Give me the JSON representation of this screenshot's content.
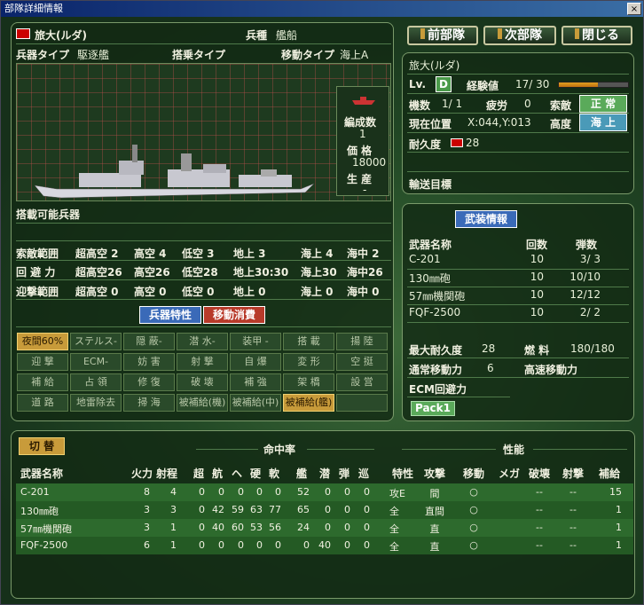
{
  "window": {
    "title": "部隊詳細情報",
    "close": "×"
  },
  "unit": {
    "name": "旅大(ルダ)",
    "category_label": "兵種",
    "category": "艦船",
    "weapon_type_label": "兵器タイプ",
    "weapon_type": "駆逐艦",
    "board_type_label": "搭乗タイプ",
    "move_type_label": "移動タイプ",
    "move_type": "海上A",
    "formation_label": "編成数",
    "formation": "1",
    "price_label": "価 格",
    "price": "18000",
    "production_label": "生 産",
    "production": "-",
    "carry_label": "搭載可能兵器"
  },
  "ranges": [
    {
      "label": "索敵範囲",
      "values": [
        "超高空 2",
        "高空 4",
        "低空 3",
        "地上 3",
        "海上 4",
        "海中 2"
      ]
    },
    {
      "label": "回 避 力",
      "values": [
        "超高空26",
        "高空26",
        "低空28",
        "地上30:30",
        "海上30",
        "海中26"
      ]
    },
    {
      "label": "迎撃範囲",
      "values": [
        "超高空 0",
        "高空 0",
        "低空 0",
        "地上 0",
        "海上 0",
        "海中 0"
      ]
    }
  ],
  "mode_tabs": [
    "兵器特性",
    "移動消費"
  ],
  "abilities": [
    [
      "夜間60%",
      "ステルス-",
      "隠 蔽-",
      "潜 水-",
      "装甲 -",
      "搭 載",
      "揚 陸"
    ],
    [
      "迎 撃",
      "ECM-",
      "妨 害",
      "射 撃",
      "自 爆",
      "変 形",
      "空 挺"
    ],
    [
      "補 給",
      "占 領",
      "修 復",
      "破 壊",
      "補 強",
      "架 橋",
      "設 営"
    ],
    [
      "道 路",
      "地雷除去",
      "掃 海",
      "被補給(機)",
      "被補給(中)",
      "被補給(艦)",
      ""
    ]
  ],
  "buttons": {
    "prev": "前部隊",
    "next": "次部隊",
    "close": "閉じる"
  },
  "status": {
    "name": "旅大(ルダ)",
    "lv_label": "Lv.",
    "lv": "D",
    "exp_label": "経験値",
    "exp": "17/ 30",
    "exp_fraction": 0.57,
    "units_label": "機数",
    "units": "1/ 1",
    "fatigue_label": "疲労",
    "fatigue": "0",
    "morale_label": "索敵",
    "morale": "正 常",
    "pos_label": "現在位置",
    "pos": "X:044,Y:013",
    "alt_label": "高度",
    "alt": "海 上",
    "dur_label": "耐久度",
    "dur": "28",
    "transport_label": "輸送目標"
  },
  "arms": {
    "header": "武装情報",
    "cols": [
      "武器名称",
      "回数",
      "弾数"
    ],
    "rows": [
      {
        "name": "C-201",
        "times": "10",
        "ammo": "3/ 3"
      },
      {
        "name": "130㎜砲",
        "times": "10",
        "ammo": "10/10"
      },
      {
        "name": "57㎜機関砲",
        "times": "10",
        "ammo": "12/12"
      },
      {
        "name": "FQF-2500",
        "times": "10",
        "ammo": "2/ 2"
      }
    ],
    "max_dur_label": "最大耐久度",
    "max_dur": "28",
    "fuel_label": "燃 料",
    "fuel": "180/180",
    "move_label": "通常移動力",
    "move": "6",
    "fast_label": "高速移動力",
    "ecm_label": "ECM回避力",
    "pack": "Pack1"
  },
  "weapons": {
    "toggle": "切 替",
    "hit_header": "命中率",
    "perf_header": "性能",
    "cols": [
      "武器名称",
      "火力",
      "射程",
      "超",
      "航",
      "ヘ",
      "硬",
      "軟",
      "艦",
      "潜",
      "弾",
      "巡",
      "特性",
      "攻撃",
      "移動",
      "メガ",
      "破壊",
      "射撃",
      "補給"
    ],
    "rows": [
      [
        "C-201",
        "8",
        "4",
        "0",
        "0",
        "0",
        "0",
        "0",
        "52",
        "0",
        "0",
        "0",
        "攻E",
        "間",
        "○",
        "",
        "--",
        "--",
        "15"
      ],
      [
        "130㎜砲",
        "3",
        "3",
        "0",
        "42",
        "59",
        "63",
        "77",
        "65",
        "0",
        "0",
        "0",
        "全",
        "直間",
        "○",
        "",
        "--",
        "--",
        "1"
      ],
      [
        "57㎜機関砲",
        "3",
        "1",
        "0",
        "40",
        "60",
        "53",
        "56",
        "24",
        "0",
        "0",
        "0",
        "全",
        "直",
        "○",
        "",
        "--",
        "--",
        "1"
      ],
      [
        "FQF-2500",
        "6",
        "1",
        "0",
        "0",
        "0",
        "0",
        "0",
        "0",
        "40",
        "0",
        "0",
        "全",
        "直",
        "○",
        "",
        "--",
        "--",
        "1"
      ]
    ]
  }
}
